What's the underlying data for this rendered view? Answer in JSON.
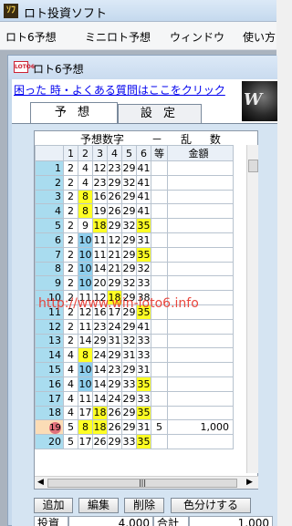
{
  "window": {
    "title": "ロト投資ソフト",
    "app_icon_label": "ｿﾌ"
  },
  "menu": [
    "ロト6予想",
    "ミニロト予想",
    "ウィンドウ",
    "使い方"
  ],
  "child_window": {
    "title": "ロト6予想",
    "icon_label": "LOTO6"
  },
  "help_link": "困った 時・よくある質問はここをクリック",
  "banner_text": "W",
  "tabs": [
    {
      "label": "予 想",
      "active": true
    },
    {
      "label": "設 定",
      "active": false
    }
  ],
  "grid": {
    "heading": {
      "title": "予想数字",
      "dash": "－",
      "mode": "乱 数"
    },
    "columns": [
      "1",
      "2",
      "3",
      "4",
      "5",
      "6",
      "等",
      "金額"
    ],
    "rows": [
      {
        "n": "1",
        "nums": [
          "2",
          "4",
          "12",
          "23",
          "29",
          "41"
        ],
        "rank": "",
        "amount": ""
      },
      {
        "n": "2",
        "nums": [
          "2",
          "4",
          "23",
          "29",
          "32",
          "41"
        ],
        "rank": "",
        "amount": ""
      },
      {
        "n": "3",
        "nums": [
          "2",
          "8",
          "16",
          "26",
          "29",
          "41"
        ],
        "rank": "",
        "amount": ""
      },
      {
        "n": "4",
        "nums": [
          "2",
          "8",
          "19",
          "26",
          "29",
          "41"
        ],
        "rank": "",
        "amount": ""
      },
      {
        "n": "5",
        "nums": [
          "2",
          "9",
          "18",
          "29",
          "32",
          "35"
        ],
        "rank": "",
        "amount": ""
      },
      {
        "n": "6",
        "nums": [
          "2",
          "10",
          "11",
          "12",
          "29",
          "31"
        ],
        "rank": "",
        "amount": ""
      },
      {
        "n": "7",
        "nums": [
          "2",
          "10",
          "11",
          "21",
          "29",
          "35"
        ],
        "rank": "",
        "amount": ""
      },
      {
        "n": "8",
        "nums": [
          "2",
          "10",
          "14",
          "21",
          "29",
          "32"
        ],
        "rank": "",
        "amount": ""
      },
      {
        "n": "9",
        "nums": [
          "2",
          "10",
          "20",
          "29",
          "32",
          "33"
        ],
        "rank": "",
        "amount": ""
      },
      {
        "n": "10",
        "nums": [
          "2",
          "11",
          "12",
          "18",
          "29",
          "38"
        ],
        "rank": "",
        "amount": ""
      },
      {
        "n": "11",
        "nums": [
          "2",
          "12",
          "16",
          "17",
          "29",
          "35"
        ],
        "rank": "",
        "amount": ""
      },
      {
        "n": "12",
        "nums": [
          "2",
          "11",
          "23",
          "24",
          "29",
          "41"
        ],
        "rank": "",
        "amount": ""
      },
      {
        "n": "13",
        "nums": [
          "2",
          "14",
          "29",
          "31",
          "32",
          "33"
        ],
        "rank": "",
        "amount": ""
      },
      {
        "n": "14",
        "nums": [
          "4",
          "8",
          "24",
          "29",
          "31",
          "33"
        ],
        "rank": "",
        "amount": ""
      },
      {
        "n": "15",
        "nums": [
          "4",
          "10",
          "14",
          "23",
          "29",
          "31"
        ],
        "rank": "",
        "amount": ""
      },
      {
        "n": "16",
        "nums": [
          "4",
          "10",
          "14",
          "29",
          "33",
          "35"
        ],
        "rank": "",
        "amount": ""
      },
      {
        "n": "17",
        "nums": [
          "4",
          "11",
          "14",
          "24",
          "29",
          "33"
        ],
        "rank": "",
        "amount": ""
      },
      {
        "n": "18",
        "nums": [
          "4",
          "17",
          "18",
          "26",
          "29",
          "35"
        ],
        "rank": "",
        "amount": ""
      },
      {
        "n": "19",
        "nums": [
          "5",
          "8",
          "18",
          "26",
          "29",
          "31"
        ],
        "rank": "5",
        "amount": "1,000"
      },
      {
        "n": "20",
        "nums": [
          "5",
          "17",
          "26",
          "29",
          "33",
          "35"
        ],
        "rank": "",
        "amount": ""
      }
    ],
    "watermark": "http://www.win-loto6.info"
  },
  "buttons": [
    "追加",
    "編集",
    "削除",
    "色分けする"
  ],
  "summary": {
    "invest_label": "投資",
    "invest_value": "4,000",
    "total_label": "合計",
    "total_value": "1,000"
  }
}
